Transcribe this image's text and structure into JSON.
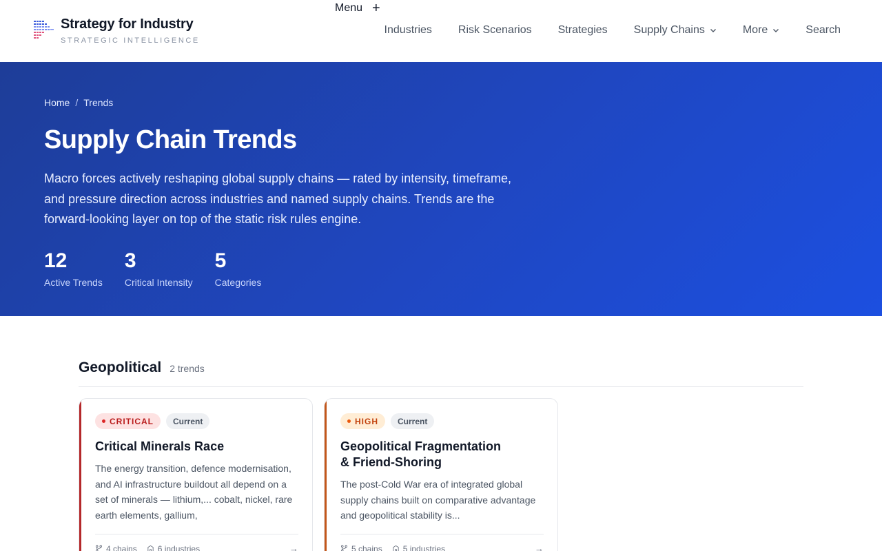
{
  "header": {
    "brand_title": "Strategy for Industry",
    "brand_subtitle": "STRATEGIC INTELLIGENCE",
    "menu_label": "Menu",
    "nav": [
      {
        "label": "Industries"
      },
      {
        "label": "Risk Scenarios"
      },
      {
        "label": "Strategies"
      },
      {
        "label": "Supply Chains",
        "has_dropdown": true
      },
      {
        "label": "More",
        "has_dropdown": true
      },
      {
        "label": "Search"
      }
    ]
  },
  "hero": {
    "breadcrumb": [
      "Home",
      "Trends"
    ],
    "title": "Supply Chain Trends",
    "description": "Macro forces actively reshaping global supply chains — rated by intensity, timeframe, and pressure direction across industries and named supply chains. Trends are the forward-looking layer on top of the static risk rules engine.",
    "stats": [
      {
        "value": "12",
        "label": "Active Trends"
      },
      {
        "value": "3",
        "label": "Critical Intensity"
      },
      {
        "value": "5",
        "label": "Categories"
      }
    ]
  },
  "section": {
    "title": "Geopolitical",
    "count": "2 trends",
    "cards": [
      {
        "intensity": "CRITICAL",
        "timeframe": "Current",
        "title": "Critical Minerals Race",
        "description": "The energy transition, defence modernisation, and AI infrastructure buildout all depend on a set of minerals — lithium,... cobalt, nickel, rare earth elements, gallium,",
        "chains": "4 chains",
        "industries": "6 industries"
      },
      {
        "intensity": "HIGH",
        "timeframe": "Current",
        "title": "Geopolitical Fragmentation & Friend-Shoring",
        "description": "The post-Cold War era of integrated global supply chains built on comparative advantage and geopolitical stability is...",
        "chains": "5 chains",
        "industries": "5 industries"
      }
    ]
  },
  "colors": {
    "hero_gradient_start": "#1e3d98",
    "hero_gradient_end": "#1c4fe0",
    "critical": "#b91c1c",
    "high": "#c2410c"
  },
  "icons": [
    "logo-grid-icon",
    "plus-icon",
    "chevron-down-icon",
    "branch-icon",
    "building-icon",
    "arrow-right-icon"
  ]
}
